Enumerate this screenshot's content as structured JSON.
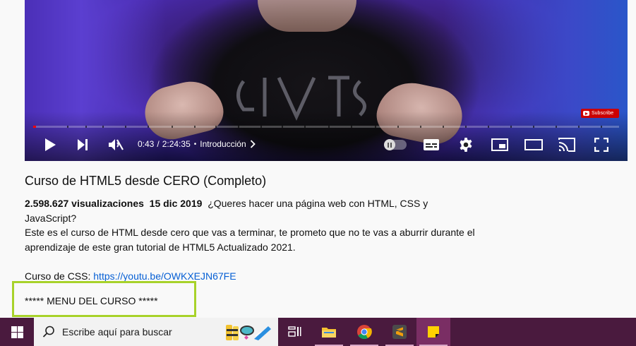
{
  "player": {
    "subscribe_label": "Subscribe",
    "time_current": "0:43",
    "time_separator": "/",
    "time_total": "2:24:35",
    "bullet": "•",
    "chapter": "Introducción",
    "played_fraction": 0.005,
    "accent_color": "#ff0000"
  },
  "video": {
    "title": "Curso de HTML5 desde CERO (Completo)",
    "views": "2.598.627 visualizaciones",
    "date": "15 dic 2019",
    "desc_line1": "¿Queres hacer una página web con HTML, CSS y JavaScript?",
    "desc_line2": "Este es el curso de HTML desde cero que vas a terminar, te prometo que no te vas a aburrir durante el aprendizaje de este gran tutorial de HTML5 Actualizado 2021.",
    "css_label": "Curso de CSS:",
    "css_link": "https://youtu.be/OWKXEJN67FE",
    "menu_line": "***** MENU DEL CURSO *****"
  },
  "taskbar": {
    "search_placeholder": "Escribe aquí para buscar",
    "apps": [
      "task-view",
      "file-explorer",
      "chrome",
      "sublime-text",
      "sticky-notes"
    ],
    "background_color": "#4a1a3e"
  }
}
